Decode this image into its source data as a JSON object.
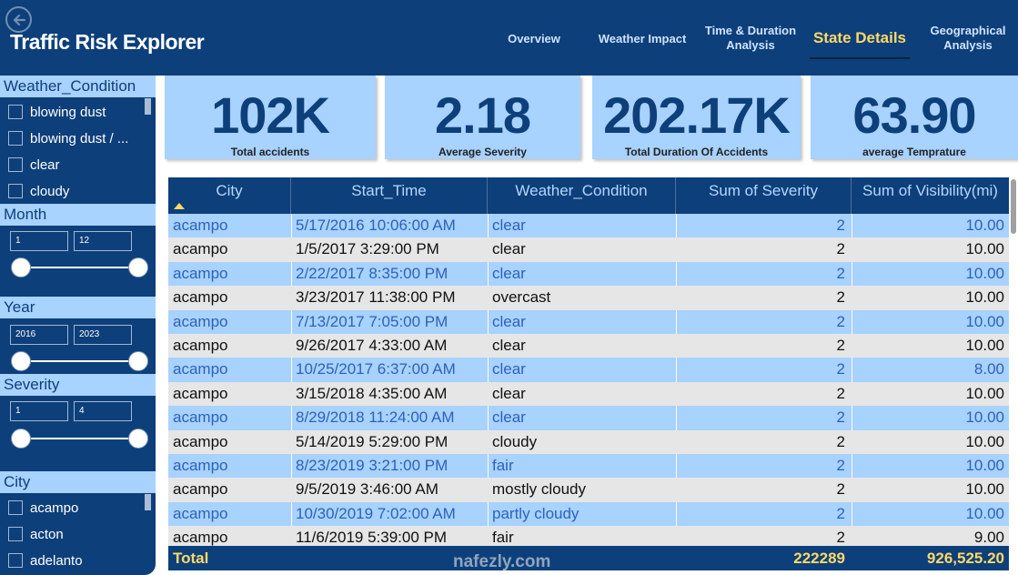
{
  "app": {
    "title": "Traffic Risk Explorer"
  },
  "nav": {
    "tabs": [
      {
        "label": "Overview"
      },
      {
        "label": "Weather Impact"
      },
      {
        "label": "Time & Duration Analysis"
      },
      {
        "label": "State Details"
      },
      {
        "label": "Geographical Analysis"
      }
    ],
    "active": "State Details"
  },
  "sidebar": {
    "weather": {
      "title": "Weather_Condition",
      "items": [
        "blowing dust",
        "blowing dust / ...",
        "clear",
        "cloudy"
      ]
    },
    "month": {
      "title": "Month",
      "min": "1",
      "max": "12"
    },
    "year": {
      "title": "Year",
      "min": "2016",
      "max": "2023"
    },
    "severity": {
      "title": "Severity",
      "min": "1",
      "max": "4"
    },
    "city": {
      "title": "City",
      "items": [
        "acampo",
        "acton",
        "adelanto"
      ]
    }
  },
  "kpis": [
    {
      "value": "102K",
      "label": "Total accidents"
    },
    {
      "value": "2.18",
      "label": "Average Severity"
    },
    {
      "value": "202.17K",
      "label": "Total Duration Of Accidents"
    },
    {
      "value": "63.90",
      "label": "average Temprature"
    }
  ],
  "table": {
    "columns": [
      "City",
      "Start_Time",
      "Weather_Condition",
      "Sum of Severity",
      "Sum of Visibility(mi)"
    ],
    "rows": [
      [
        "acampo",
        "5/17/2016 10:06:00 AM",
        "clear",
        "2",
        "10.00"
      ],
      [
        "acampo",
        "1/5/2017 3:29:00 PM",
        "clear",
        "2",
        "10.00"
      ],
      [
        "acampo",
        "2/22/2017 8:35:00 PM",
        "clear",
        "2",
        "10.00"
      ],
      [
        "acampo",
        "3/23/2017 11:38:00 PM",
        "overcast",
        "2",
        "10.00"
      ],
      [
        "acampo",
        "7/13/2017 7:05:00 PM",
        "clear",
        "2",
        "10.00"
      ],
      [
        "acampo",
        "9/26/2017 4:33:00 AM",
        "clear",
        "2",
        "10.00"
      ],
      [
        "acampo",
        "10/25/2017 6:37:00 AM",
        "clear",
        "2",
        "8.00"
      ],
      [
        "acampo",
        "3/15/2018 4:35:00 AM",
        "clear",
        "2",
        "10.00"
      ],
      [
        "acampo",
        "8/29/2018 11:24:00 AM",
        "clear",
        "2",
        "10.00"
      ],
      [
        "acampo",
        "5/14/2019 5:29:00 PM",
        "cloudy",
        "2",
        "10.00"
      ],
      [
        "acampo",
        "8/23/2019 3:21:00 PM",
        "fair",
        "2",
        "10.00"
      ],
      [
        "acampo",
        "9/5/2019 3:46:00 AM",
        "mostly cloudy",
        "2",
        "10.00"
      ],
      [
        "acampo",
        "10/30/2019 7:02:00 AM",
        "partly cloudy",
        "2",
        "10.00"
      ],
      [
        "acampo",
        "11/6/2019 5:39:00 PM",
        "fair",
        "2",
        "9.00"
      ]
    ],
    "total": {
      "label": "Total",
      "severity": "222289",
      "visibility": "926,525.20"
    }
  },
  "watermark": "nafezly.com",
  "colors": {
    "navy": "#0d3f7a",
    "light_blue": "#a8d2ff",
    "accent_yellow": "#ffd966"
  }
}
